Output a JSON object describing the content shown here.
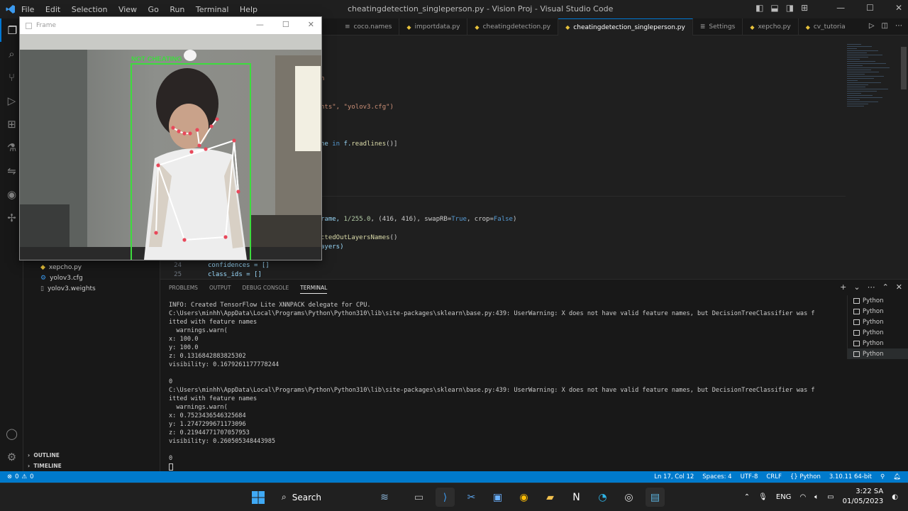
{
  "window": {
    "title": "cheatingdetection_singleperson.py - Vision Proj - Visual Studio Code",
    "menu": [
      "File",
      "Edit",
      "Selection",
      "View",
      "Go",
      "Run",
      "Terminal",
      "Help"
    ]
  },
  "frame_window": {
    "title": "Frame",
    "label": "NOT CHEATING"
  },
  "tabs": [
    {
      "label": "coco.names",
      "icon": "file-lines-icon"
    },
    {
      "label": "importdata.py",
      "icon": "python-icon"
    },
    {
      "label": "cheatingdetection.py",
      "icon": "python-icon"
    },
    {
      "label": "cheatingdetection_singleperson.py",
      "icon": "python-icon",
      "active": true
    },
    {
      "label": "Settings",
      "icon": "settings-icon"
    },
    {
      "label": "xepcho.py",
      "icon": "python-icon"
    },
    {
      "label": "cv_tutoria",
      "icon": "python-icon"
    }
  ],
  "editor": {
    "frag1": "n",
    "frag2a": "hts\", ",
    "frag2b": "\"yolov3.cfg\")",
    "frag3a": "ne ",
    "frag3b": "in ",
    "frag3c": "f.",
    "frag3d": "readlines",
    "frag3e": "()]",
    "frag4a": "rame, ",
    "frag4b": "1/255.0",
    "frag4c": ", (416, 416), swapRB=",
    "frag4d": "True",
    "frag4e": ", crop=",
    "frag4f": "False",
    "frag4g": ")",
    "frag5a": "ctedOutLayersNames",
    "frag5b": "()",
    "frag6": "ayers)",
    "line24_num": "24",
    "line24_code": "confidences = []",
    "line25_num": "25",
    "line25_code": "class_ids = []"
  },
  "sidebar": {
    "files": [
      "xepcho.py",
      "yolov3.cfg",
      "yolov3.weights"
    ],
    "outline": "OUTLINE",
    "timeline": "TIMELINE"
  },
  "panel": {
    "tabs": [
      "PROBLEMS",
      "OUTPUT",
      "DEBUG CONSOLE",
      "TERMINAL"
    ],
    "terminal_lines": [
      "INFO: Created TensorFlow Lite XNNPACK delegate for CPU.",
      "C:\\Users\\minhh\\AppData\\Local\\Programs\\Python\\Python310\\lib\\site-packages\\sklearn\\base.py:439: UserWarning: X does not have valid feature names, but DecisionTreeClassifier was f",
      "itted with feature names",
      "  warnings.warn(",
      "x: 100.0",
      "y: 100.0",
      "z: 0.1316842883825302",
      "visibility: 0.1679261177778244",
      "",
      "0",
      "C:\\Users\\minhh\\AppData\\Local\\Programs\\Python\\Python310\\lib\\site-packages\\sklearn\\base.py:439: UserWarning: X does not have valid feature names, but DecisionTreeClassifier was f",
      "itted with feature names",
      "  warnings.warn(",
      "x: 0.7523436546325684",
      "y: 1.2747299671173096",
      "z: 0.21944771707057953",
      "visibility: 0.260505348443985",
      "",
      "0"
    ],
    "terminal_instances": [
      "Python",
      "Python",
      "Python",
      "Python",
      "Python",
      "Python"
    ]
  },
  "statusbar": {
    "errors": "0",
    "warnings": "0",
    "position": "Ln 17, Col 12",
    "spaces": "Spaces: 4",
    "encoding": "UTF-8",
    "eol": "CRLF",
    "language": "Python",
    "interpreter": "3.10.11 64-bit"
  },
  "taskbar": {
    "search": "Search",
    "lang": "ENG",
    "time": "3:22 SA",
    "date": "01/05/2023"
  },
  "colors": {
    "accent": "#007acc",
    "bbox": "#3ddc3d",
    "skeleton_joint": "#e8485a"
  }
}
